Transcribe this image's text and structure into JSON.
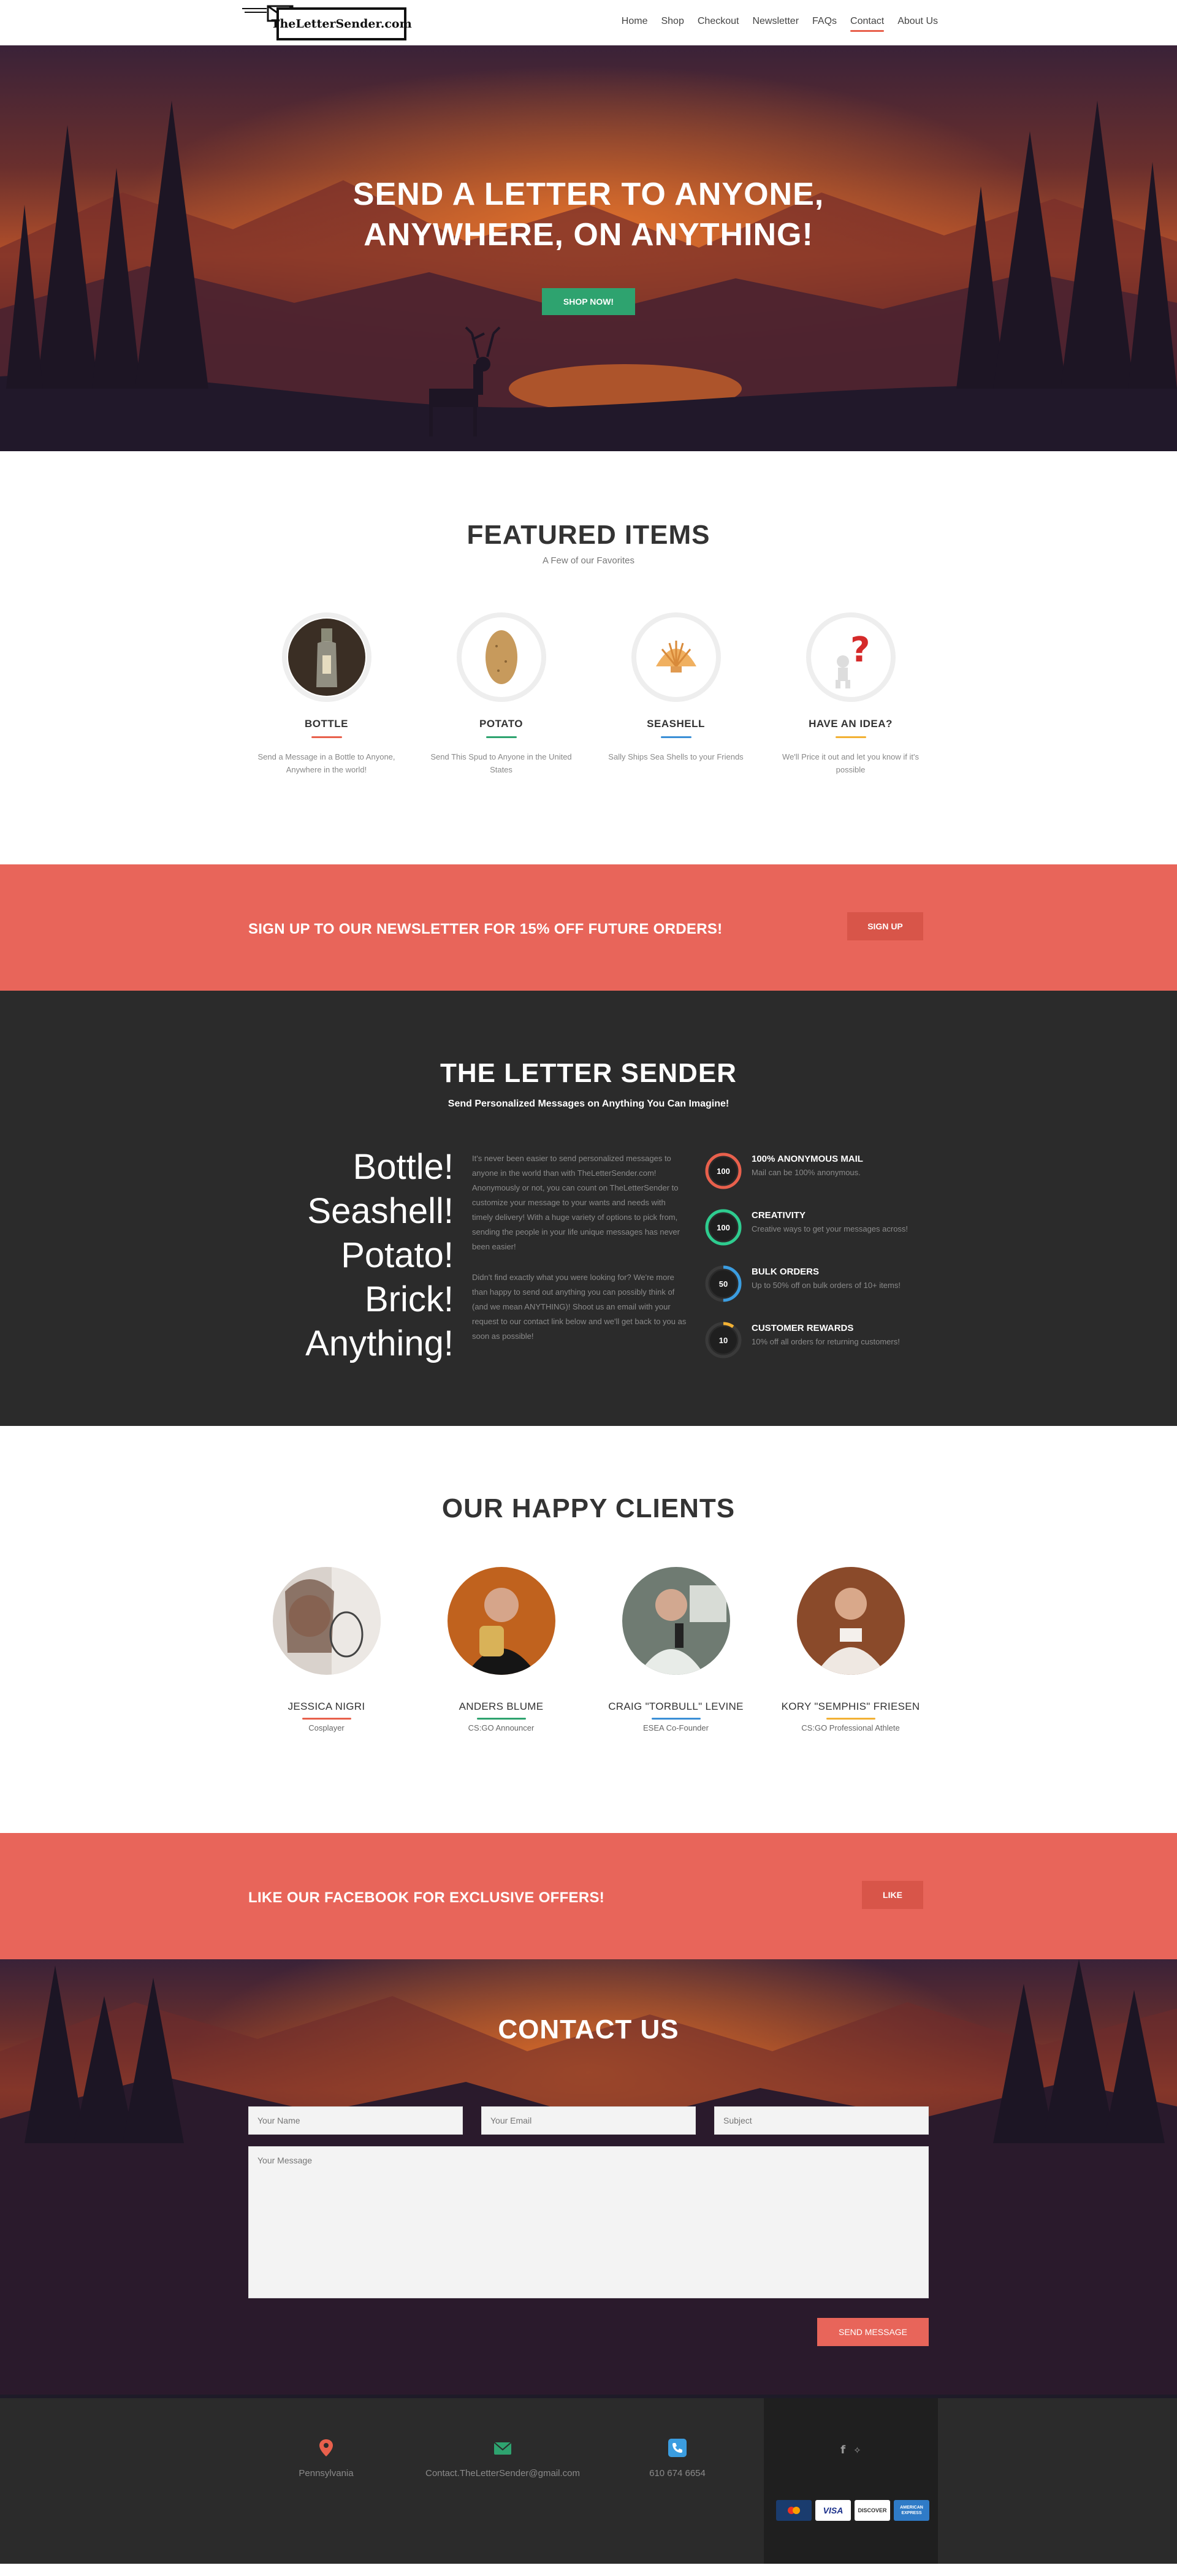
{
  "nav": {
    "logo_text": "TheLetterSender.com",
    "items": [
      {
        "label": "Home"
      },
      {
        "label": "Shop"
      },
      {
        "label": "Checkout"
      },
      {
        "label": "Newsletter"
      },
      {
        "label": "FAQs"
      },
      {
        "label": "Contact",
        "active": true
      },
      {
        "label": "About Us"
      }
    ]
  },
  "hero": {
    "title_line1": "SEND A LETTER TO ANYONE,",
    "title_line2": "ANYWHERE, ON ANYTHING!",
    "button": "SHOP NOW!"
  },
  "featured": {
    "title": "FEATURED ITEMS",
    "subtitle": "A Few of our Favorites",
    "items": [
      {
        "name": "BOTTLE",
        "desc": "Send a Message in a Bottle to Anyone, Anywhere in the world!",
        "color": "#e8604c"
      },
      {
        "name": "POTATO",
        "desc": "Send This Spud to Anyone in the United States",
        "color": "#2ea36f"
      },
      {
        "name": "SEASHELL",
        "desc": "Sally Ships Sea Shells to your Friends",
        "color": "#3b8fd6"
      },
      {
        "name": "HAVE AN IDEA?",
        "desc": "We'll Price it out and let you know if it's possible",
        "color": "#f2b134"
      }
    ]
  },
  "newsletter": {
    "text": "SIGN UP TO OUR NEWSLETTER FOR 15% OFF FUTURE ORDERS!",
    "button": "SIGN UP"
  },
  "about": {
    "title": "THE LETTER SENDER",
    "subtitle": "Send Personalized Messages on Anything You Can Imagine!",
    "words": [
      "Bottle!",
      "Seashell!",
      "Potato!",
      "Brick!",
      "Anything!"
    ],
    "para1": "It's never been easier to send personalized messages to anyone in the world than with TheLetterSender.com! Anonymously or not, you can count on TheLetterSender to customize your message to your wants and needs with timely delivery! With a huge variety of options to pick from, sending the people in your life unique messages has never been easier!",
    "para2": "Didn't find exactly what you were looking for? We're more than happy to send out anything you can possibly think of (and we mean ANYTHING)! Shoot us an email with your request to our contact link below and we'll get back to you as soon as possible!",
    "stats": [
      {
        "value": "100",
        "percent": 100,
        "title": "100% ANONYMOUS MAIL",
        "desc": "Mail can be 100% anonymous.",
        "color": "#e8604c"
      },
      {
        "value": "100",
        "percent": 100,
        "title": "CREATIVITY",
        "desc": "Creative ways to get your messages across!",
        "color": "#2ecc8f"
      },
      {
        "value": "50",
        "percent": 50,
        "title": "BULK ORDERS",
        "desc": "Up to 50% off on bulk orders of 10+ items!",
        "color": "#3b9de0"
      },
      {
        "value": "10",
        "percent": 10,
        "title": "CUSTOMER REWARDS",
        "desc": "10% off all orders for returning customers!",
        "color": "#f2b134"
      }
    ]
  },
  "clients": {
    "title": "OUR HAPPY CLIENTS",
    "items": [
      {
        "name": "JESSICA NIGRI",
        "role": "Cosplayer",
        "color": "#e8604c"
      },
      {
        "name": "ANDERS BLUME",
        "role": "CS:GO Announcer",
        "color": "#2ea36f"
      },
      {
        "name": "CRAIG \"TORBULL\" LEVINE",
        "role": "ESEA Co-Founder",
        "color": "#3b8fd6"
      },
      {
        "name": "KORY \"SEMPHIS\" FRIESEN",
        "role": "CS:GO Professional Athlete",
        "color": "#f2b134"
      }
    ]
  },
  "facebook": {
    "text": "LIKE OUR FACEBOOK FOR EXCLUSIVE OFFERS!",
    "button": "LIKE"
  },
  "contact": {
    "title": "CONTACT US",
    "name_placeholder": "Your Name",
    "email_placeholder": "Your Email",
    "subject_placeholder": "Subject",
    "message_placeholder": "Your Message",
    "button": "SEND MESSAGE"
  },
  "footer": {
    "location": "Pennsylvania",
    "email": "Contact.TheLetterSender@gmail.com",
    "phone": "610 674 6654",
    "social": "f  🐦",
    "cards": [
      "MasterCard",
      "VISA",
      "DISCOVER",
      "AMERICAN EXPRESS"
    ]
  },
  "icons": {
    "logo": "envelope-icon",
    "location": "map-pin-icon",
    "email": "envelope-icon",
    "phone": "phone-icon",
    "facebook": "facebook-icon",
    "twitter": "twitter-icon"
  },
  "colors": {
    "accent": "#e8655a",
    "green": "#2ea36f",
    "dark": "#2b2b2b"
  }
}
